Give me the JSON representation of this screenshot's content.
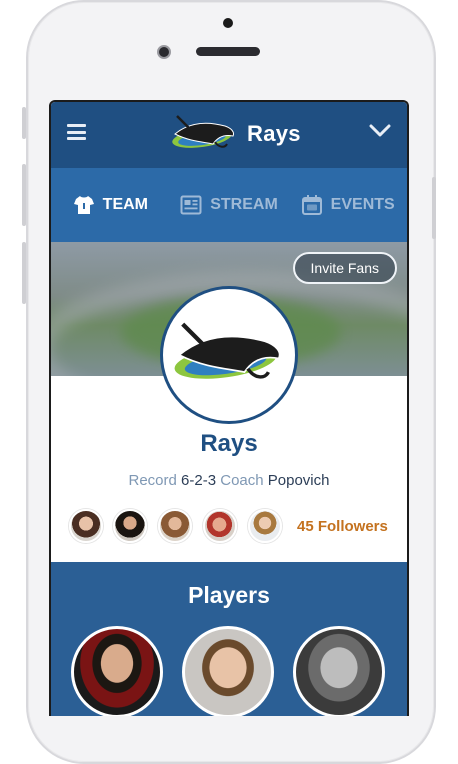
{
  "header": {
    "title": "Rays",
    "menu_icon": "hamburger-menu-icon",
    "dropdown_icon": "chevron-down-icon"
  },
  "tabs": [
    {
      "label": "TEAM",
      "icon": "jersey-icon",
      "active": true
    },
    {
      "label": "STREAM",
      "icon": "newspaper-icon",
      "active": false
    },
    {
      "label": "EVENTS",
      "icon": "calendar-icon",
      "active": false
    }
  ],
  "hero": {
    "invite_label": "Invite Fans"
  },
  "team": {
    "name": "Rays",
    "record_label": "Record",
    "record_value": "6-2-3",
    "coach_label": "Coach",
    "coach_value": "Popovich"
  },
  "followers": {
    "label": "45 Followers"
  },
  "players": {
    "title": "Players"
  },
  "colors": {
    "primary": "#1f4f82",
    "tabs": "#2c6aa8",
    "accent": "#c4721f",
    "players_bg": "#2b5f95"
  }
}
